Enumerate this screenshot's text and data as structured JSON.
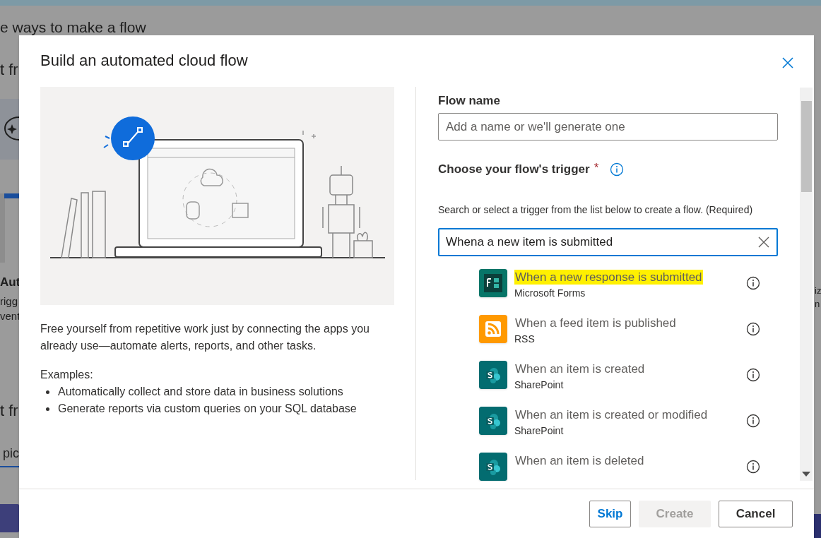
{
  "background": {
    "heading": "e ways to make a flow",
    "fragments": [
      {
        "text": "t fr"
      },
      {
        "text": "Aut"
      },
      {
        "text": "rigg"
      },
      {
        "text": "vent"
      },
      {
        "text": "t fr"
      },
      {
        "text": "pic"
      },
      {
        "text": "iz"
      },
      {
        "text": "n"
      }
    ]
  },
  "dialog": {
    "title": "Build an automated cloud flow",
    "description": "Free yourself from repetitive work just by connecting the apps you already use—automate alerts, reports, and other tasks.",
    "examples_label": "Examples:",
    "examples": [
      "Automatically collect and store data in business solutions",
      "Generate reports via custom queries on your SQL database"
    ],
    "flow_name": {
      "label": "Flow name",
      "placeholder": "Add a name or we'll generate one"
    },
    "trigger": {
      "label": "Choose your flow's trigger",
      "required_mark": "*",
      "helper": "Search or select a trigger from the list below to create a flow. (Required)",
      "search_value": "Whena a new item is submitted"
    },
    "triggers": [
      {
        "title": "When a new response is submitted",
        "connector": "Microsoft Forms",
        "kind": "forms",
        "highlighted": true
      },
      {
        "title": "When a feed item is published",
        "connector": "RSS",
        "kind": "rss",
        "highlighted": false
      },
      {
        "title": "When an item is created",
        "connector": "SharePoint",
        "kind": "sharepoint",
        "highlighted": false
      },
      {
        "title": "When an item is created or modified",
        "connector": "SharePoint",
        "kind": "sharepoint",
        "highlighted": false
      },
      {
        "title": "When an item is deleted",
        "kind": "sharepoint",
        "highlighted": false
      }
    ],
    "buttons": [
      {
        "label": "Skip",
        "kind": "outline",
        "disabled": false
      },
      {
        "label": "Create",
        "kind": "primary",
        "disabled": true
      },
      {
        "label": "Cancel",
        "kind": "default",
        "disabled": false
      }
    ]
  }
}
